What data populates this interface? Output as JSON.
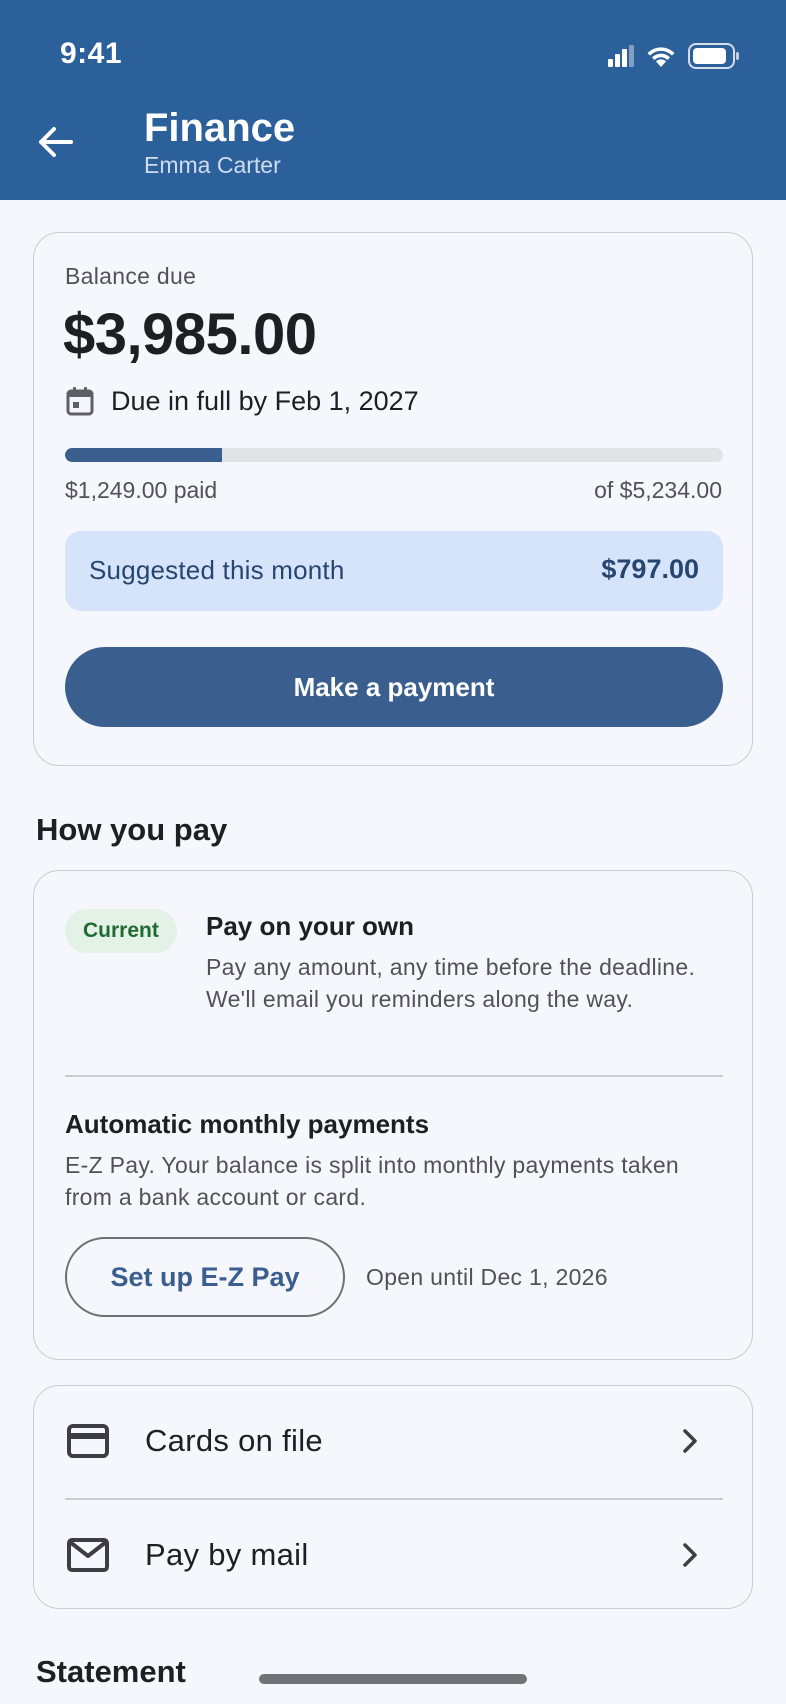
{
  "status_bar": {
    "time": "9:41"
  },
  "header": {
    "title": "Finance",
    "subtitle": "Emma Carter"
  },
  "balance": {
    "label": "Balance due",
    "amount": "$3,985.00",
    "due_text": "Due in full by Feb 1, 2027",
    "paid_text": "$1,249.00 paid",
    "of_text": "of $5,234.00",
    "progress_fraction": 0.239,
    "suggested_label": "Suggested this month",
    "suggested_value": "$797.00",
    "pay_button_label": "Make a payment"
  },
  "how_you_pay": {
    "heading": "How you pay",
    "current": {
      "badge": "Current",
      "title": "Pay on your own",
      "description": "Pay any amount, any time before the deadline. We'll email you reminders along the way."
    },
    "automatic": {
      "title": "Automatic monthly payments",
      "description": "E-Z Pay. Your balance is split into monthly payments taken from a bank account or card.",
      "button_label": "Set up E-Z Pay",
      "open_until": "Open until Dec 1, 2026"
    }
  },
  "links": [
    {
      "label": "Cards on file",
      "icon": "credit-card-icon"
    },
    {
      "label": "Pay by mail",
      "icon": "mail-icon"
    }
  ],
  "statement": {
    "heading": "Statement"
  },
  "colors": {
    "header_bg": "#2c609b",
    "primary": "#3a5f8f",
    "suggest_bg": "#d6e4fb",
    "badge_bg": "#e3f1e6",
    "badge_text": "#1f6a35"
  }
}
